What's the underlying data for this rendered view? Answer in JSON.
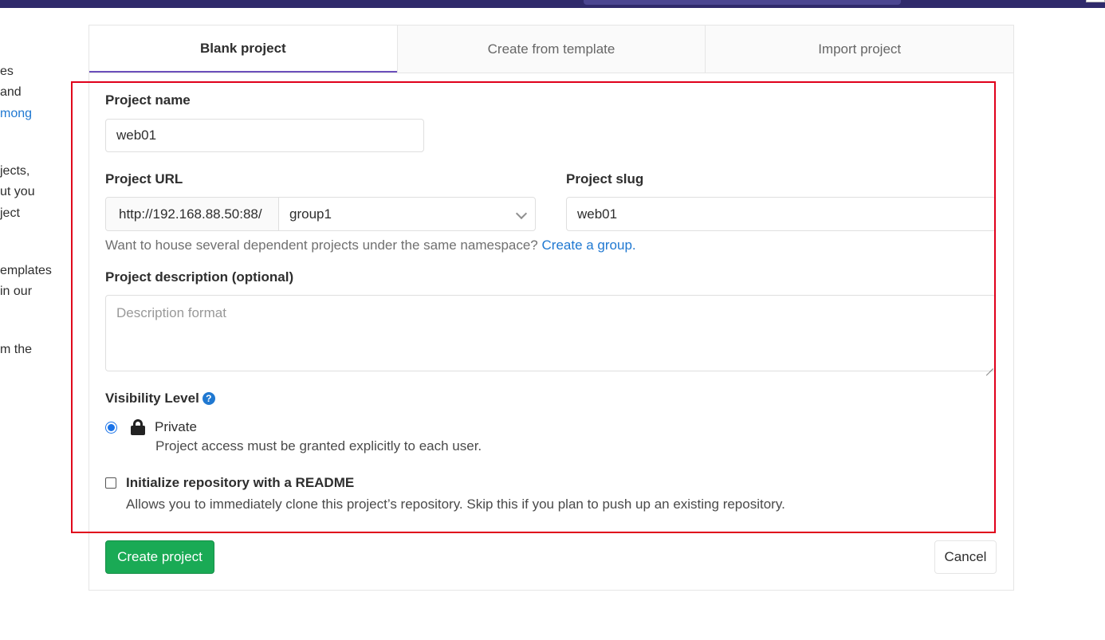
{
  "side_fragments": [
    {
      "text": "es",
      "link": false
    },
    {
      "text": "and",
      "link": false
    },
    {
      "text": "mong",
      "link": true
    },
    {
      "text": "jects,",
      "link": false
    },
    {
      "text": "ut you",
      "link": false
    },
    {
      "text": "ject",
      "link": false
    },
    {
      "text": "emplates",
      "link": false
    },
    {
      "text": " in our",
      "link": false
    },
    {
      "text": "m the",
      "link": false
    }
  ],
  "tabs": [
    {
      "label": "Blank project",
      "active": true
    },
    {
      "label": "Create from template",
      "active": false
    },
    {
      "label": "Import project",
      "active": false
    }
  ],
  "form": {
    "project_name": {
      "label": "Project name",
      "value": "web01"
    },
    "project_url": {
      "label": "Project URL",
      "prefix": "http://192.168.88.50:88/",
      "namespace": "group1"
    },
    "project_slug": {
      "label": "Project slug",
      "value": "web01"
    },
    "namespace_help": {
      "text": "Want to house several dependent projects under the same namespace?",
      "link": "Create a group."
    },
    "description": {
      "label": "Project description (optional)",
      "placeholder": "Description format",
      "value": ""
    },
    "visibility": {
      "label": "Visibility Level",
      "help_icon": "question-circle-icon",
      "help_glyph": "?",
      "option": {
        "title": "Private",
        "description": "Project access must be granted explicitly to each user.",
        "selected": true,
        "icon": "lock-icon"
      }
    },
    "readme": {
      "label": "Initialize repository with a README",
      "description": "Allows you to immediately clone this project’s repository. Skip this if you plan to push up an existing repository.",
      "checked": false
    }
  },
  "buttons": {
    "create": "Create project",
    "cancel": "Cancel"
  },
  "colors": {
    "navbar": "#2f2a6b",
    "accent_tab": "#6b4fbb",
    "link": "#1f78d1",
    "primary_button": "#1aaa55",
    "highlight_border": "#e0001b"
  }
}
